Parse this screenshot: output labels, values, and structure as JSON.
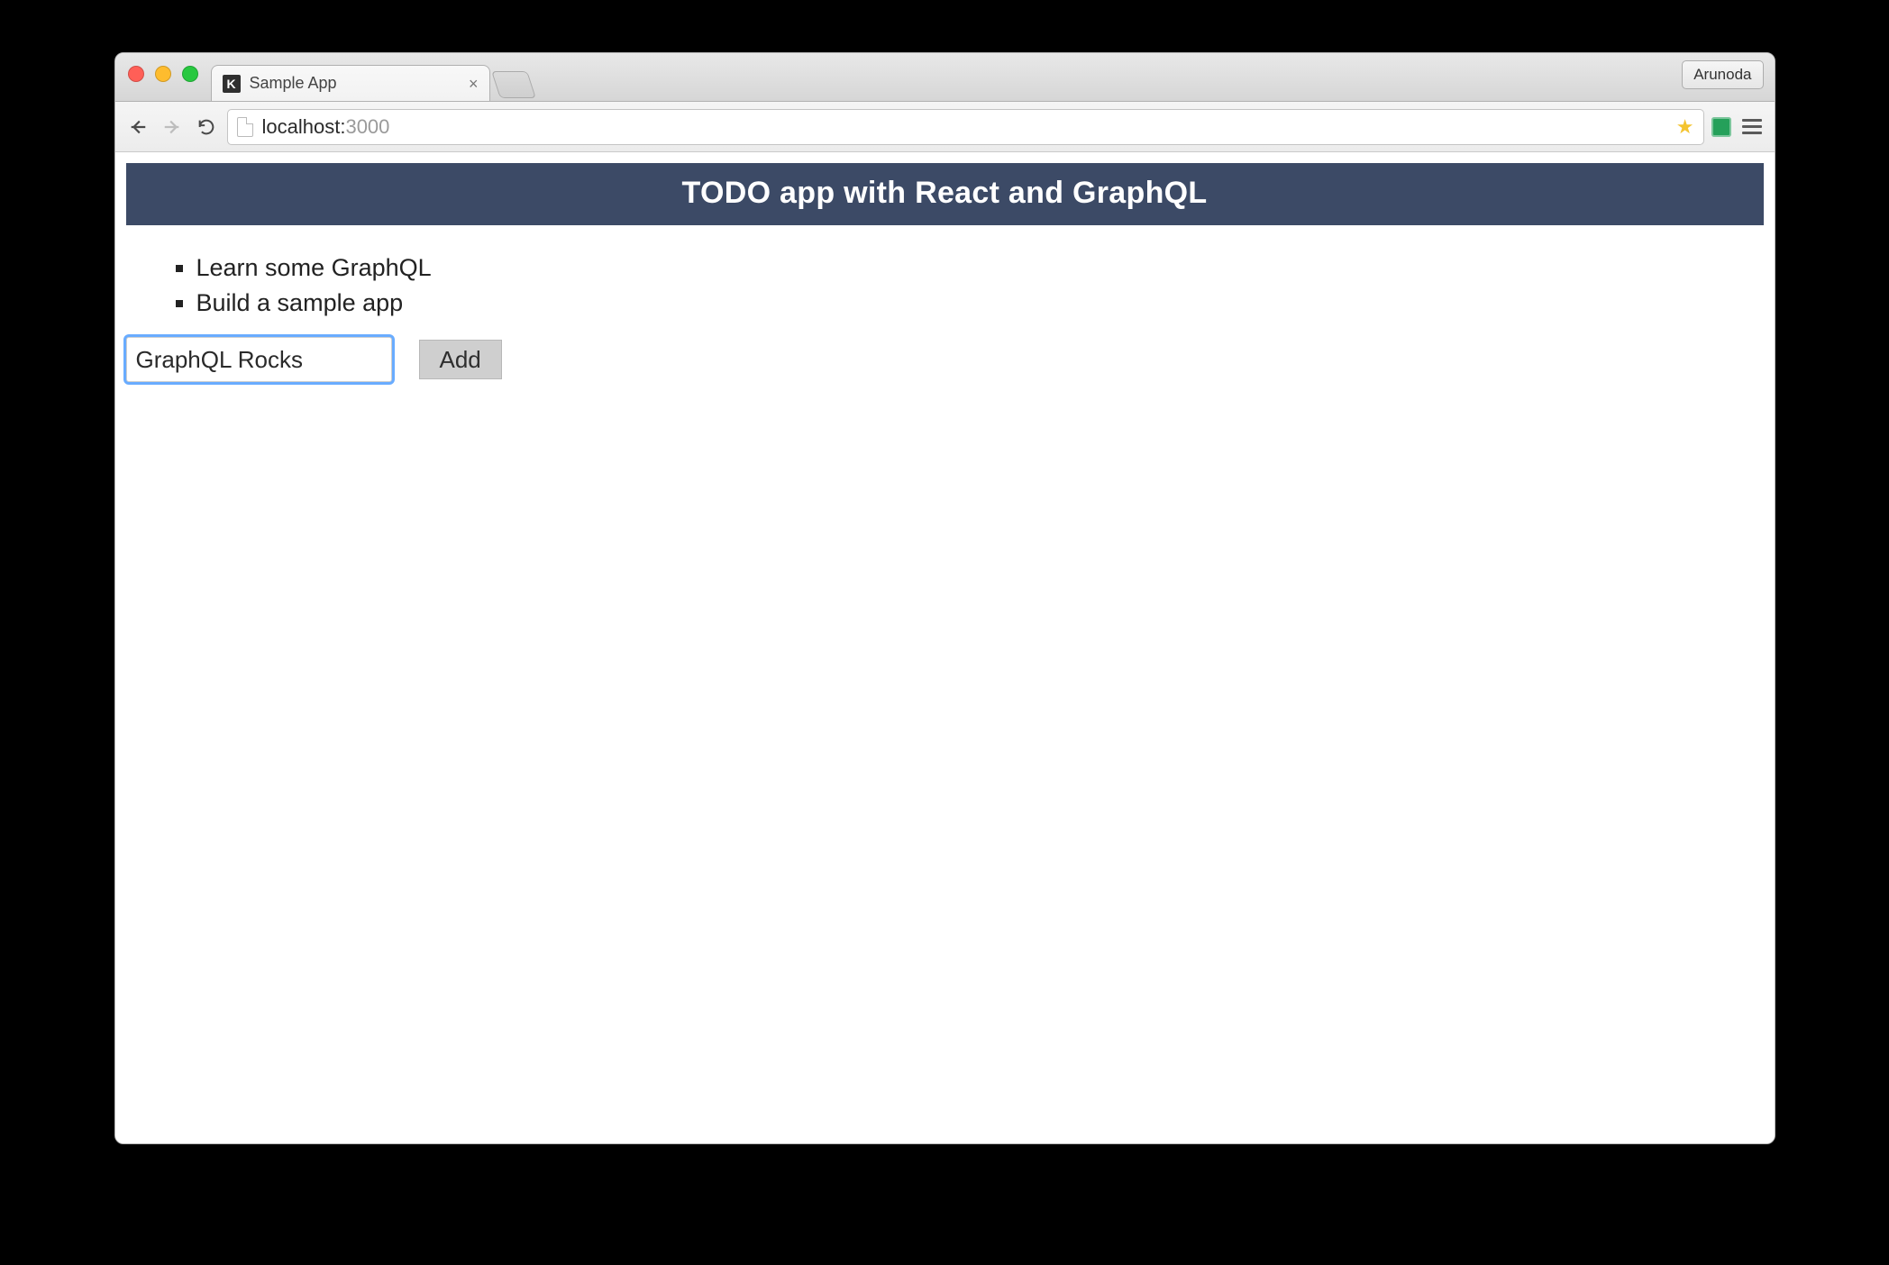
{
  "browser": {
    "tab_title": "Sample App",
    "profile_name": "Arunoda",
    "url_host": "localhost:",
    "url_rest": "3000"
  },
  "app": {
    "header_title": "TODO app with React and GraphQL",
    "todos": [
      "Learn some GraphQL",
      "Build a sample app"
    ],
    "input_value": "GraphQL Rocks",
    "add_button_label": "Add"
  },
  "colors": {
    "header_bg": "#3c4a66"
  }
}
